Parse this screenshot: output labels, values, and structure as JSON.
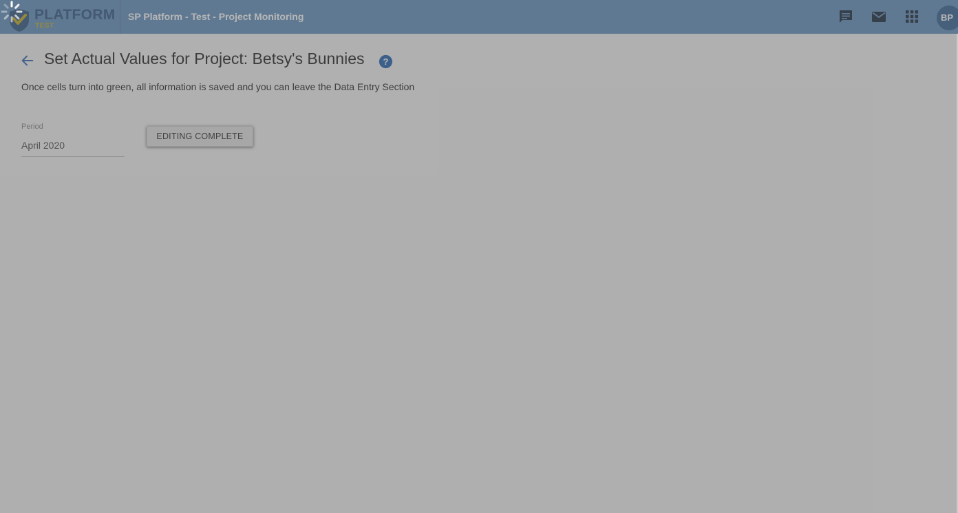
{
  "topbar": {
    "logo_text": "PLATFORM",
    "logo_sub": "TEST",
    "app_title": "SP Platform - Test - Project Monitoring",
    "icons": [
      "chat-icon",
      "mail-icon",
      "apps-grid-icon"
    ],
    "avatar_initials": "BP"
  },
  "page": {
    "title": "Set Actual Values for Project: Betsy's Bunnies",
    "subtitle": "Once cells turn into green, all information is saved and you can leave the Data Entry Section"
  },
  "period": {
    "label": "Period",
    "value": "April 2020"
  },
  "actions": {
    "editing_complete_label": "EDITING COMPLETE"
  },
  "state": {
    "loading": true
  },
  "colors": {
    "topbar": "#6b96c2",
    "accent": "#3b6fb6",
    "logo_sub": "#c9b22f"
  }
}
